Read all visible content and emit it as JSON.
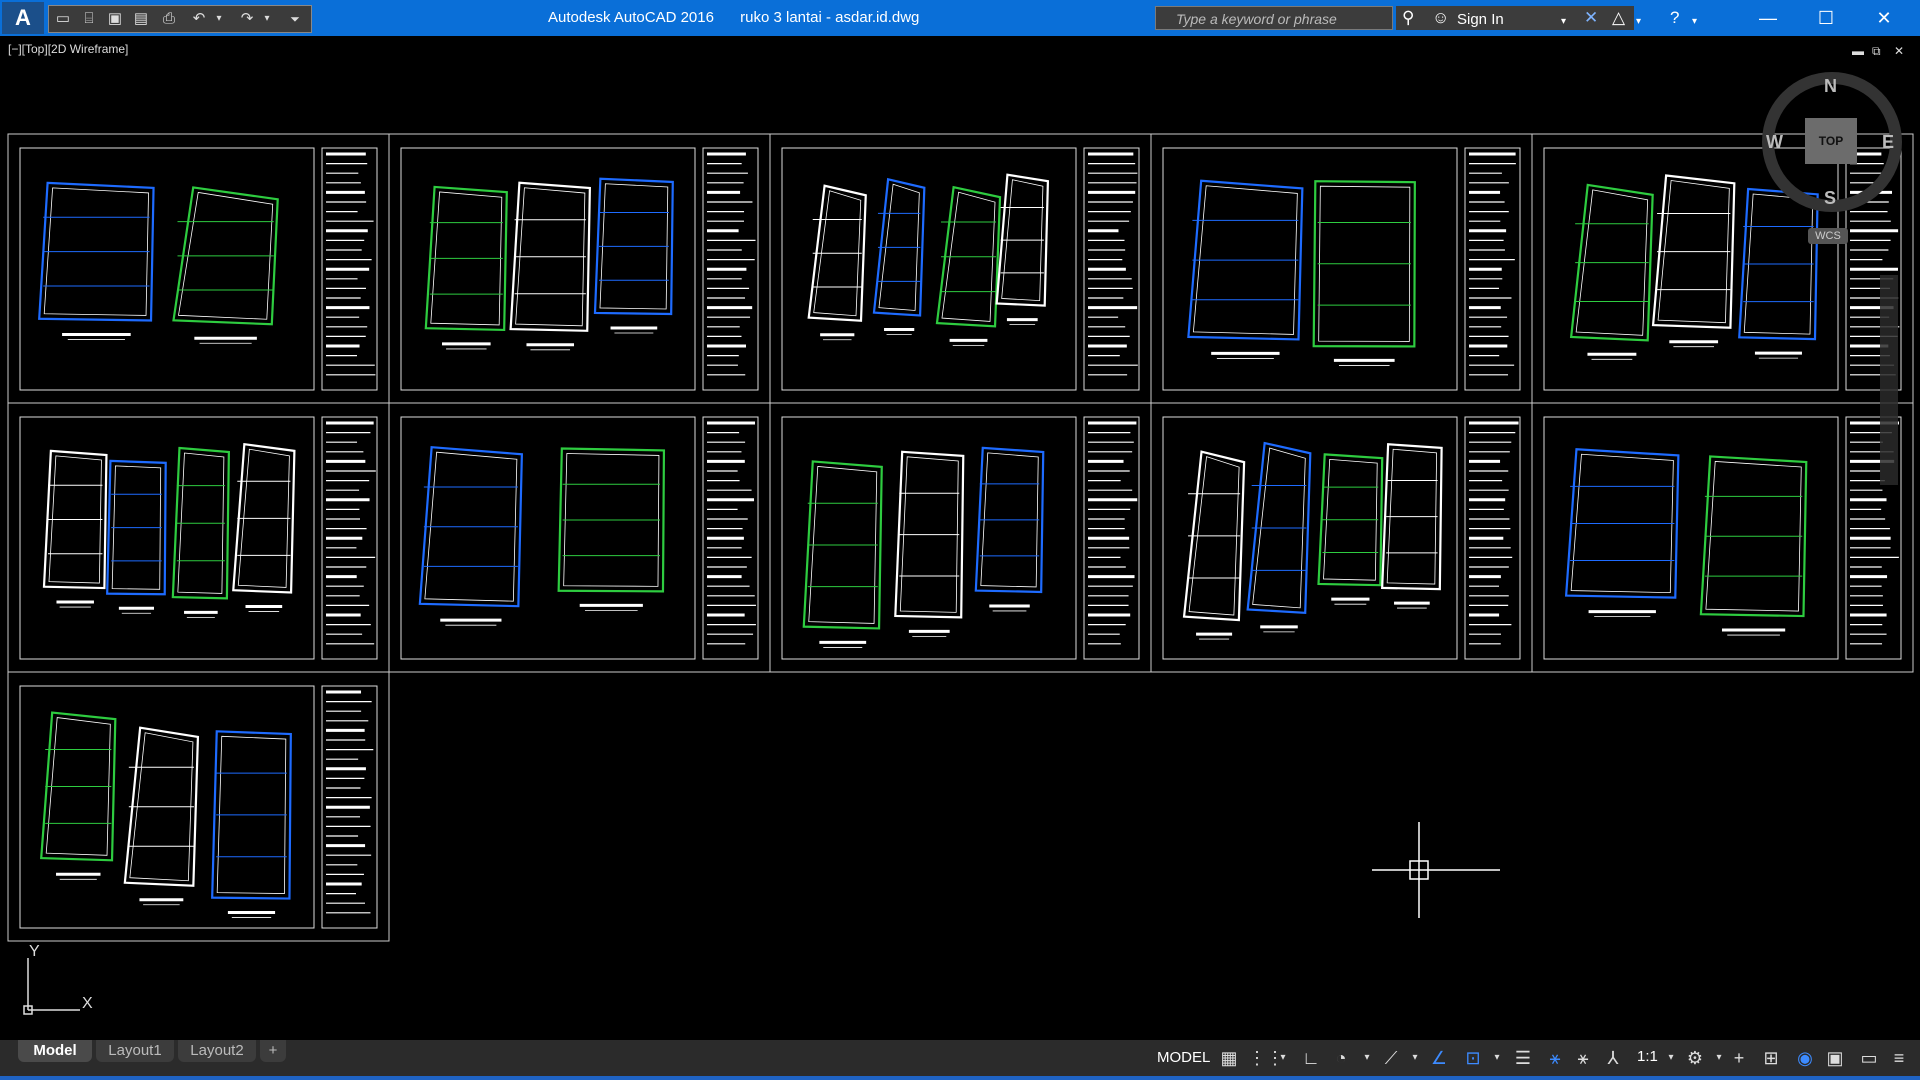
{
  "window": {
    "app_name": "Autodesk AutoCAD 2016",
    "document": "ruko 3 lantai - asdar.id.dwg"
  },
  "search": {
    "placeholder": "Type a keyword or phrase"
  },
  "account": {
    "sign_in_label": "Sign In"
  },
  "viewport": {
    "label": "[−][Top][2D Wireframe]"
  },
  "viewcube": {
    "north": "N",
    "south": "S",
    "east": "E",
    "west": "W",
    "face": "TOP",
    "wcs": "WCS"
  },
  "ucs": {
    "x_label": "X",
    "y_label": "Y"
  },
  "tabs": [
    {
      "label": "Model",
      "active": true
    },
    {
      "label": "Layout1",
      "active": false
    },
    {
      "label": "Layout2",
      "active": false
    },
    {
      "label": "+",
      "active": false
    }
  ],
  "status": {
    "mode": "MODEL",
    "annotation_scale": "1:1"
  },
  "colors": {
    "titlebar": "#0a6fd8",
    "canvas": "#000000",
    "statusbar": "#2b2b2b",
    "blue_line": "#1e6bff",
    "green_line": "#2ecc40",
    "white_line": "#ffffff"
  },
  "sheets_count": 11
}
